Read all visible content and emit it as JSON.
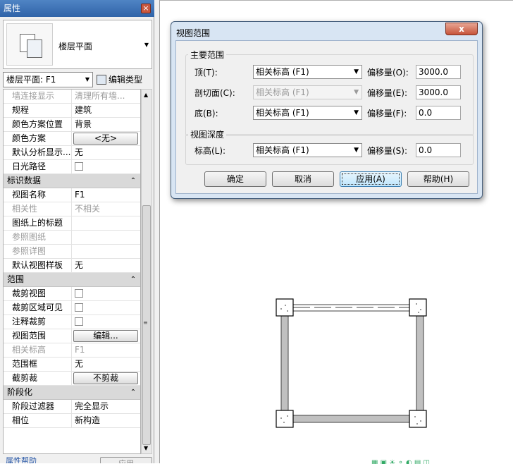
{
  "properties": {
    "title": "属性",
    "close_glyph": "×",
    "type_name": "楼层平面",
    "selector_value": "楼层平面: F1",
    "edit_type_label": "编辑类型",
    "rows": [
      {
        "kind": "prop",
        "key": "墙连接显示",
        "value": "清理所有墙...",
        "dim": true
      },
      {
        "kind": "prop",
        "key": "规程",
        "value": "建筑"
      },
      {
        "kind": "prop",
        "key": "颜色方案位置",
        "value": "背景"
      },
      {
        "kind": "button",
        "key": "颜色方案",
        "value": "<无>"
      },
      {
        "kind": "prop",
        "key": "默认分析显示...",
        "value": "无"
      },
      {
        "kind": "check",
        "key": "日光路径"
      },
      {
        "kind": "group",
        "key": "标识数据",
        "caret": "⌃"
      },
      {
        "kind": "prop",
        "key": "视图名称",
        "value": "F1"
      },
      {
        "kind": "prop",
        "key": "相关性",
        "value": "不相关",
        "dim": true
      },
      {
        "kind": "prop",
        "key": "图纸上的标题",
        "value": ""
      },
      {
        "kind": "prop",
        "key": "参照图纸",
        "value": "",
        "dim": true
      },
      {
        "kind": "prop",
        "key": "参照详图",
        "value": "",
        "dim": true
      },
      {
        "kind": "prop",
        "key": "默认视图样板",
        "value": "无"
      },
      {
        "kind": "group",
        "key": "范围",
        "caret": "⌃"
      },
      {
        "kind": "check",
        "key": "裁剪视图"
      },
      {
        "kind": "check",
        "key": "裁剪区域可见"
      },
      {
        "kind": "check",
        "key": "注释裁剪"
      },
      {
        "kind": "button",
        "key": "视图范围",
        "value": "编辑..."
      },
      {
        "kind": "prop",
        "key": "相关标高",
        "value": "F1",
        "dim": true
      },
      {
        "kind": "prop",
        "key": "范围框",
        "value": "无"
      },
      {
        "kind": "button",
        "key": "截剪裁",
        "value": "不剪裁"
      },
      {
        "kind": "group",
        "key": "阶段化",
        "caret": "⌃"
      },
      {
        "kind": "prop",
        "key": "阶段过滤器",
        "value": "完全显示"
      },
      {
        "kind": "prop",
        "key": "相位",
        "value": "新构造"
      }
    ],
    "help_link": "属性帮助",
    "apply_label": "应用"
  },
  "dialog": {
    "title": "视图范围",
    "close_glyph": "x",
    "primary_group": "主要范围",
    "depth_group": "视图深度",
    "fields": {
      "top": {
        "label": "顶(T):",
        "select": "相关标高 (F1)",
        "offset_label": "偏移量(O):",
        "offset": "3000.0"
      },
      "cut": {
        "label": "剖切面(C):",
        "select": "相关标高 (F1)",
        "offset_label": "偏移量(E):",
        "offset": "3000.0"
      },
      "bottom": {
        "label": "底(B):",
        "select": "相关标高 (F1)",
        "offset_label": "偏移量(F):",
        "offset": "0.0"
      },
      "level": {
        "label": "标高(L):",
        "select": "相关标高 (F1)",
        "offset_label": "偏移量(S):",
        "offset": "0.0"
      }
    },
    "buttons": {
      "ok": "确定",
      "cancel": "取消",
      "apply": "应用(A)",
      "help": "帮助(H)"
    }
  },
  "colors": {
    "title_bar": "#2f63a8",
    "dialog_frame": "#d8e5f3",
    "close_red": "#c7543a",
    "wall_fill": "#c0c0c0"
  }
}
